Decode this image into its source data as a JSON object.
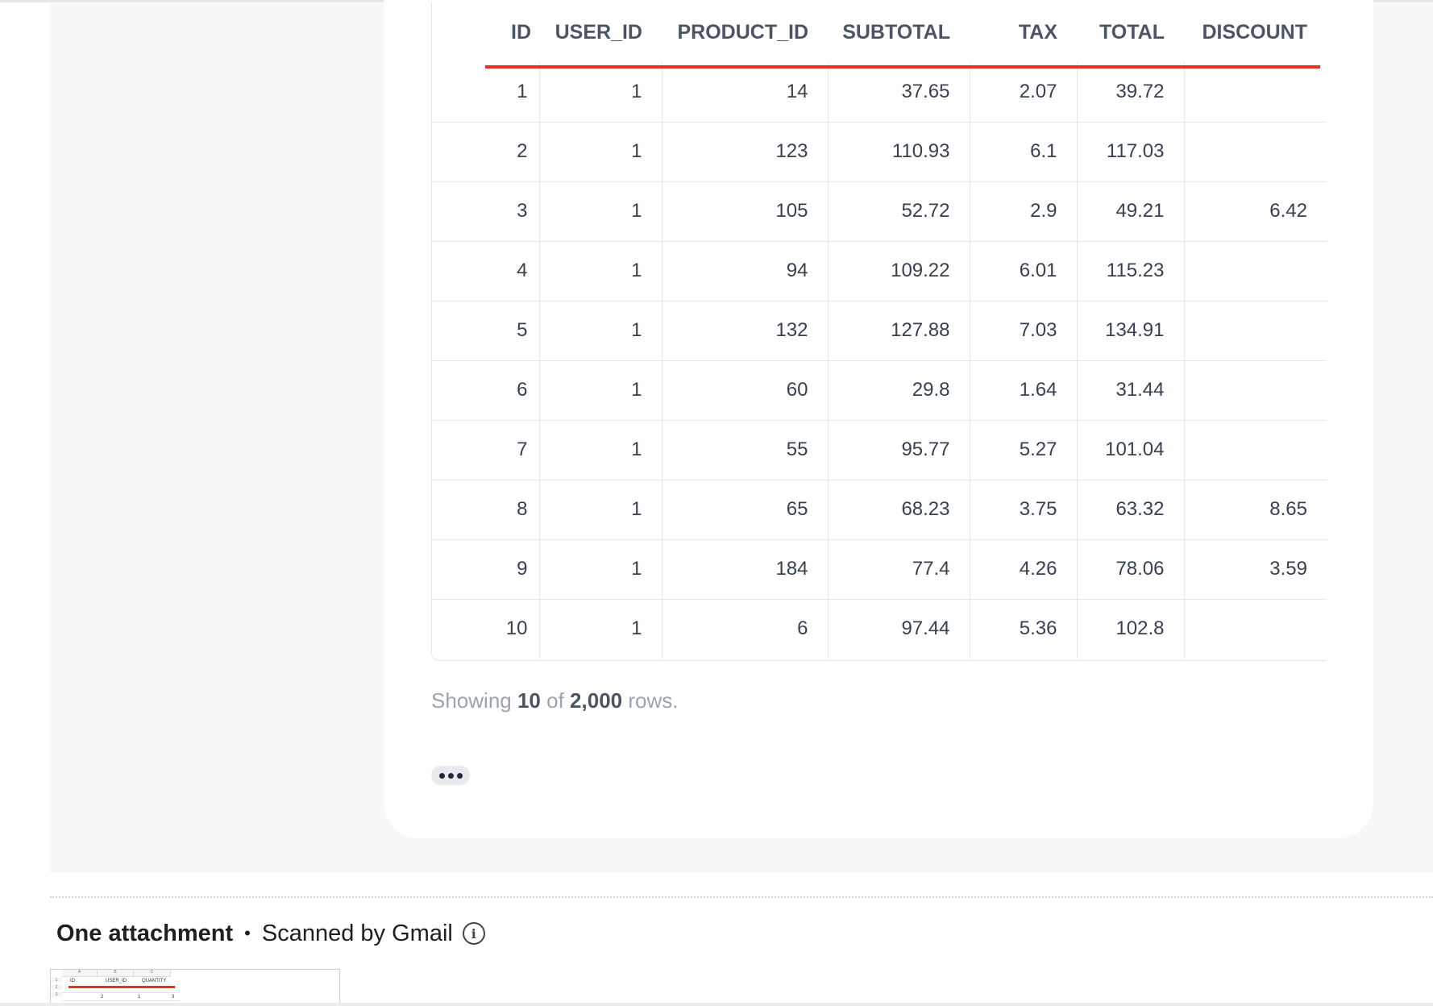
{
  "table": {
    "columns": [
      "ID",
      "USER_ID",
      "PRODUCT_ID",
      "SUBTOTAL",
      "TAX",
      "TOTAL",
      "DISCOUNT"
    ],
    "rows": [
      [
        "1",
        "1",
        "14",
        "37.65",
        "2.07",
        "39.72",
        ""
      ],
      [
        "2",
        "1",
        "123",
        "110.93",
        "6.1",
        "117.03",
        ""
      ],
      [
        "3",
        "1",
        "105",
        "52.72",
        "2.9",
        "49.21",
        "6.42"
      ],
      [
        "4",
        "1",
        "94",
        "109.22",
        "6.01",
        "115.23",
        ""
      ],
      [
        "5",
        "1",
        "132",
        "127.88",
        "7.03",
        "134.91",
        ""
      ],
      [
        "6",
        "1",
        "60",
        "29.8",
        "1.64",
        "31.44",
        ""
      ],
      [
        "7",
        "1",
        "55",
        "95.77",
        "5.27",
        "101.04",
        ""
      ],
      [
        "8",
        "1",
        "65",
        "68.23",
        "3.75",
        "63.32",
        "8.65"
      ],
      [
        "9",
        "1",
        "184",
        "77.4",
        "4.26",
        "78.06",
        "3.59"
      ],
      [
        "10",
        "1",
        "6",
        "97.44",
        "5.36",
        "102.8",
        ""
      ]
    ],
    "accent_color": "#e5331f"
  },
  "footer": {
    "prefix": "Showing",
    "shown": "10",
    "of": "of",
    "total": "2,000",
    "suffix": "rows."
  },
  "more_button": {
    "icon": "more-horizontal-icon"
  },
  "attachment": {
    "title": "One attachment",
    "separator": "•",
    "scanned": "Scanned by Gmail",
    "info_icon": "info-icon",
    "thumbnail": {
      "col_headers": [
        "A",
        "B",
        "C"
      ],
      "row_numbers": [
        "1",
        "2",
        "3"
      ],
      "header_cells": [
        "ID",
        "USER_ID",
        "QUANTITY"
      ],
      "row2": [
        "2",
        "1",
        "3"
      ]
    }
  }
}
